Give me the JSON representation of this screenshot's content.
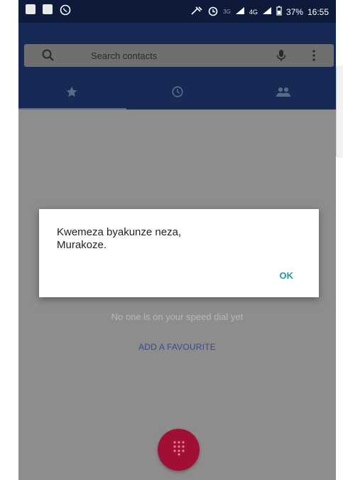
{
  "status_bar": {
    "network_label": "3G",
    "network_label_2": "4G",
    "battery": "37%",
    "time": "16:55"
  },
  "search": {
    "placeholder": "Search contacts"
  },
  "tabs": [
    {
      "icon": "star-icon"
    },
    {
      "icon": "clock-icon"
    },
    {
      "icon": "contacts-icon"
    }
  ],
  "content": {
    "empty_text": "No one is on your speed dial yet",
    "add_favourite": "ADD A FAVOURITE"
  },
  "dialog": {
    "line1": "Kwemeza byakunze neza,",
    "line2": "Murakoze.",
    "ok": "OK"
  },
  "colors": {
    "status_bar": "#0d1a3a",
    "app_bar": "#162a55",
    "dialog_ok": "#18a29b",
    "fab": "#a20f35"
  }
}
